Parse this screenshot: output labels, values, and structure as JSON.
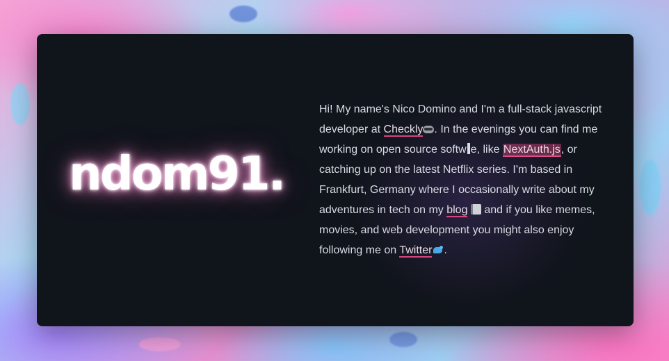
{
  "logo": {
    "text": "ndom91."
  },
  "bio": {
    "p1": "Hi! My name's Nico Domino and I'm a full-stack javascript developer at ",
    "link_checkly": "Checkly",
    "p2": ". In the evenings you can find me working on open source softw",
    "p2b": "e, like ",
    "link_nextauth": "NextAuth.js",
    "p3": ", or catching up on the latest Netflix series. I'm based in Frankfurt, Germany where I occasionally write about my adventures in tech on my ",
    "link_blog": "blog",
    "p4": " and if you like memes, movies, and web development you might also enjoy following me on ",
    "link_twitter": "Twitter",
    "p5": "."
  },
  "icons": {
    "checkly": "raccoon-icon",
    "blog": "notebook-icon",
    "twitter": "bird-icon"
  },
  "colors": {
    "card_bg": "#10141b",
    "link_underline": "#d8457f",
    "text": "#d7dbe3"
  }
}
